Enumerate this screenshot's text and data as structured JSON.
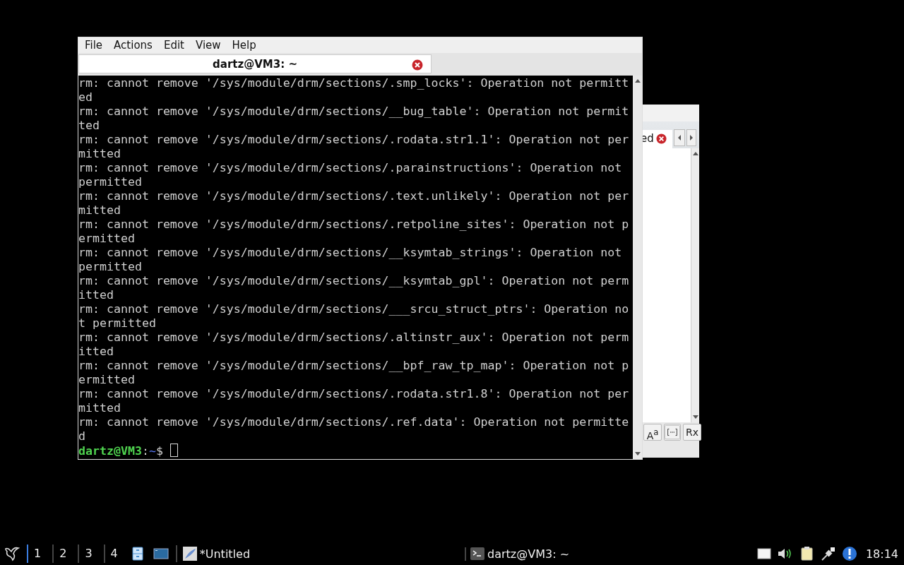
{
  "back_window": {
    "tab_label": "ed",
    "buttons": [
      "A$^{a}$",
      "Rx"
    ]
  },
  "terminal": {
    "menu": [
      "File",
      "Actions",
      "Edit",
      "View",
      "Help"
    ],
    "tabs": [
      {
        "label": "dartz@VM3: ~",
        "selected": true
      }
    ],
    "lines": [
      "rm: cannot remove '/sys/module/drm/sections/.smp_locks': Operation not permitted",
      "rm: cannot remove '/sys/module/drm/sections/__bug_table': Operation not permitted",
      "rm: cannot remove '/sys/module/drm/sections/.rodata.str1.1': Operation not permitted",
      "rm: cannot remove '/sys/module/drm/sections/.parainstructions': Operation not permitted",
      "rm: cannot remove '/sys/module/drm/sections/.text.unlikely': Operation not permitted",
      "rm: cannot remove '/sys/module/drm/sections/.retpoline_sites': Operation not permitted",
      "rm: cannot remove '/sys/module/drm/sections/__ksymtab_strings': Operation not permitted",
      "rm: cannot remove '/sys/module/drm/sections/__ksymtab_gpl': Operation not permitted",
      "rm: cannot remove '/sys/module/drm/sections/___srcu_struct_ptrs': Operation not permitted",
      "rm: cannot remove '/sys/module/drm/sections/.altinstr_aux': Operation not permitted",
      "rm: cannot remove '/sys/module/drm/sections/__bpf_raw_tp_map': Operation not permitted",
      "rm: cannot remove '/sys/module/drm/sections/.rodata.str1.8': Operation not permitted",
      "rm: cannot remove '/sys/module/drm/sections/.ref.data': Operation not permitted"
    ],
    "prompt": {
      "user_host": "dartz@VM3",
      "separator": ":",
      "path": "~",
      "symbol": "$"
    }
  },
  "taskbar": {
    "workspaces": [
      {
        "label": "1",
        "selected": true
      },
      {
        "label": "2",
        "selected": false
      },
      {
        "label": "3",
        "selected": false
      },
      {
        "label": "4",
        "selected": false
      }
    ],
    "tasks": [
      {
        "kind": "editor",
        "label": "*Untitled"
      },
      {
        "kind": "terminal",
        "label": "dartz@VM3: ~"
      }
    ],
    "clock": "18:14"
  }
}
